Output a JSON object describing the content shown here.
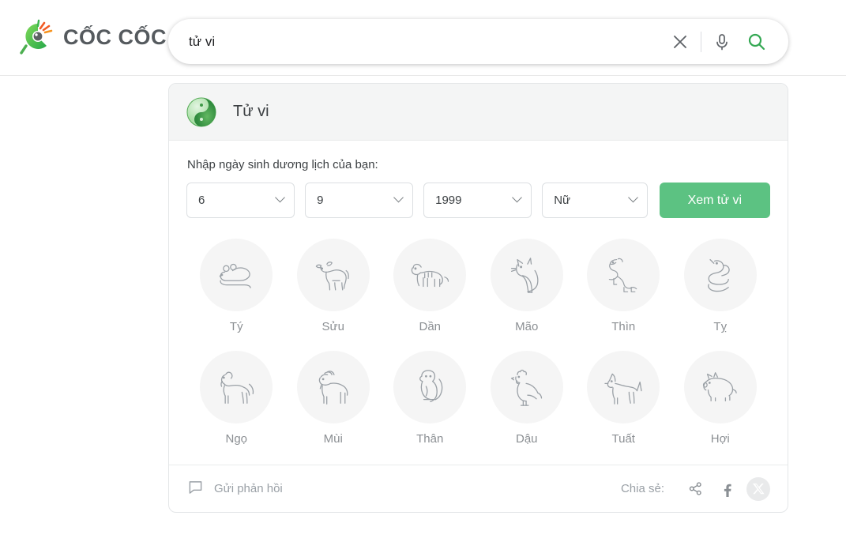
{
  "header": {
    "logo_text": "CỐC CỐC",
    "logo_icon": "coccoc-logo-icon"
  },
  "search": {
    "value": "tử vi",
    "placeholder": "",
    "clear_icon": "close-icon",
    "voice_icon": "microphone-icon",
    "search_icon": "search-icon"
  },
  "card": {
    "title": "Tử vi",
    "title_icon": "yin-yang-icon",
    "form": {
      "label": "Nhập ngày sinh dương lịch của bạn:",
      "day": "6",
      "month": "9",
      "year": "1999",
      "gender": "Nữ",
      "submit_label": "Xem tử vi",
      "chevron_icon": "chevron-down-icon",
      "accent_color": "#5cc282"
    },
    "zodiac": [
      {
        "label": "Tý",
        "icon": "rat-icon"
      },
      {
        "label": "Sửu",
        "icon": "ox-icon"
      },
      {
        "label": "Dần",
        "icon": "tiger-icon"
      },
      {
        "label": "Mão",
        "icon": "cat-icon"
      },
      {
        "label": "Thìn",
        "icon": "dragon-icon"
      },
      {
        "label": "Tỵ",
        "icon": "snake-icon"
      },
      {
        "label": "Ngọ",
        "icon": "horse-icon"
      },
      {
        "label": "Mùi",
        "icon": "goat-icon"
      },
      {
        "label": "Thân",
        "icon": "monkey-icon"
      },
      {
        "label": "Dậu",
        "icon": "rooster-icon"
      },
      {
        "label": "Tuất",
        "icon": "dog-icon"
      },
      {
        "label": "Hợi",
        "icon": "pig-icon"
      }
    ],
    "footer": {
      "feedback_label": "Gửi phản hồi",
      "feedback_icon": "speech-bubble-icon",
      "share_label": "Chia sẻ:",
      "share_icon": "share-nodes-icon",
      "facebook_icon": "facebook-icon",
      "x_icon": "x-twitter-icon"
    }
  }
}
